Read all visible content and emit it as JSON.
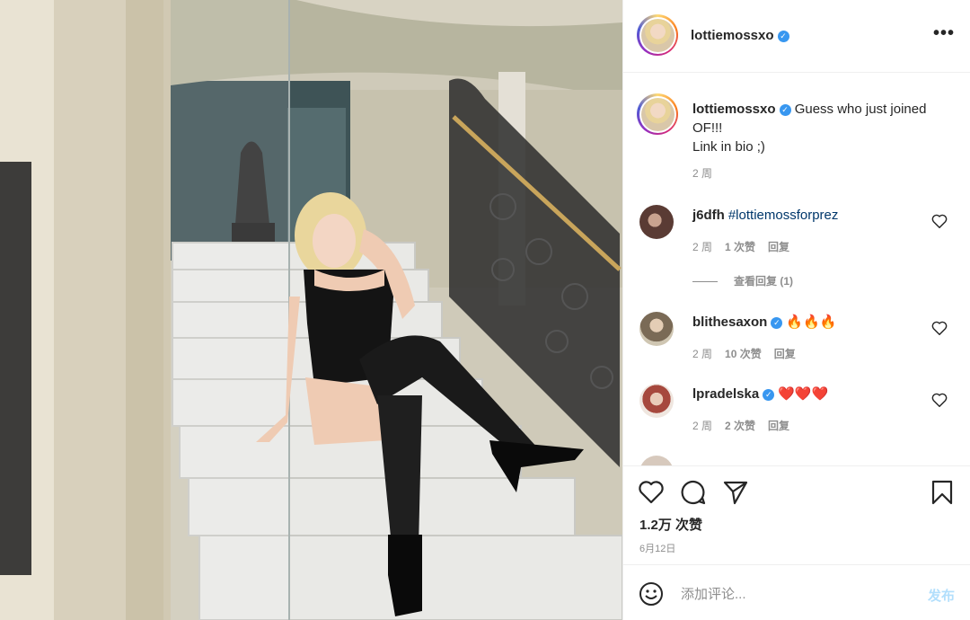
{
  "post": {
    "author": "lottiemossxo",
    "more_label": "•••"
  },
  "caption": {
    "author": "lottiemossxo",
    "text": "Guess who just joined\nOF!!!\nLink in bio ;)",
    "time": "2 周"
  },
  "comments": [
    {
      "user": "j6dfh",
      "text": "#lottiemossforprez",
      "is_hashtag": true,
      "time": "2 周",
      "likes": "1 次赞",
      "reply": "回复",
      "verified": false
    },
    {
      "user": "blithesaxon",
      "text": "🔥🔥🔥",
      "time": "2 周",
      "likes": "10 次赞",
      "reply": "回复",
      "verified": true
    },
    {
      "user": "lpradelska",
      "text": "❤️❤️❤️",
      "time": "2 周",
      "likes": "2 次赞",
      "reply": "回复",
      "verified": true
    }
  ],
  "view_replies": "查看回复 (1)",
  "stats": {
    "likes_total": "1.2万 次赞",
    "date": "6月12日"
  },
  "add_comment": {
    "placeholder": "添加评论...",
    "post_label": "发布"
  },
  "colors": {
    "link_blue": "#00376b",
    "verified_blue": "#3897f0",
    "post_disabled": "#b2dffc",
    "secondary_text": "#8e8e8e"
  },
  "icons": [
    "more-icon",
    "verified-icon",
    "heart-icon",
    "comment-icon",
    "share-icon",
    "bookmark-icon",
    "emoji-icon"
  ]
}
